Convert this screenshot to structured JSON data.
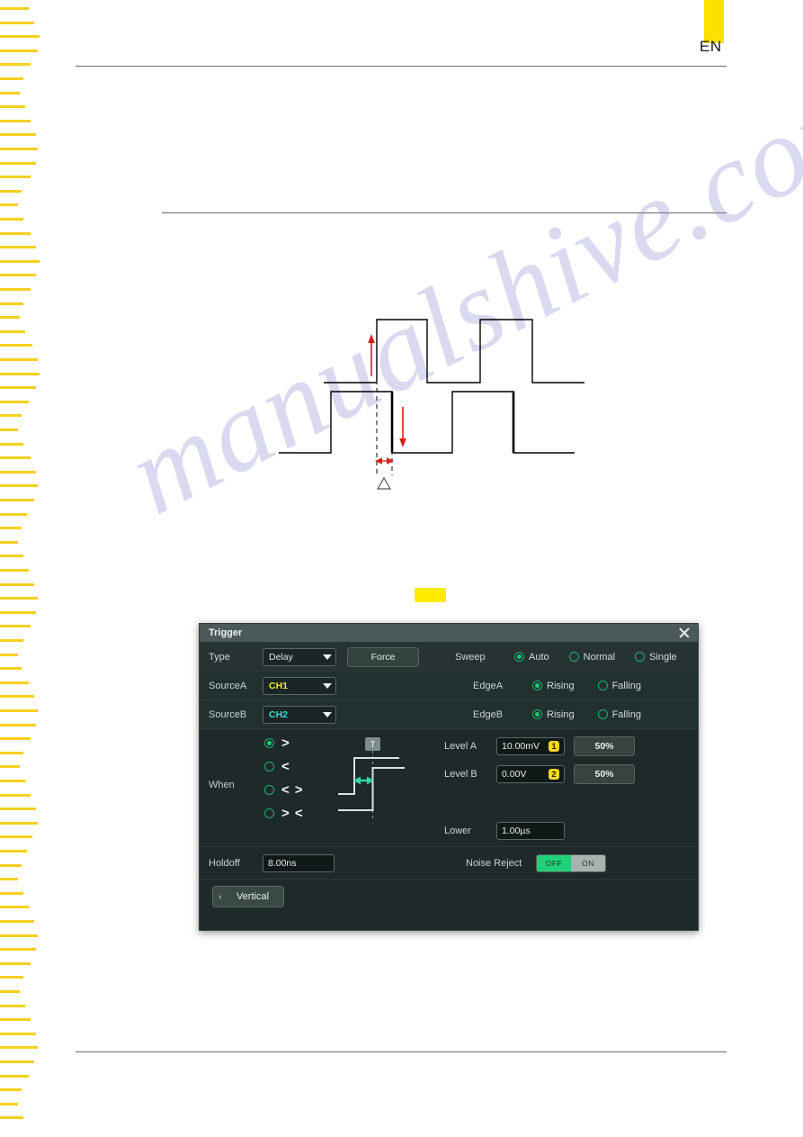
{
  "page": {
    "language_tab": "EN",
    "watermark": "manualshive.com"
  },
  "figure": {
    "name": "delay-trigger-waveform-diagram",
    "delta_marker": "△"
  },
  "dialog": {
    "title": "Trigger",
    "close_icon": "close-icon",
    "rows": {
      "type": {
        "label": "Type",
        "value": "Delay",
        "force_label": "Force",
        "sweep_label": "Sweep",
        "sweep_options": [
          {
            "label": "Auto",
            "selected": true
          },
          {
            "label": "Normal",
            "selected": false
          },
          {
            "label": "Single",
            "selected": false
          }
        ]
      },
      "source_a": {
        "label": "SourceA",
        "value": "CH1",
        "edge_label": "EdgeA",
        "edge_options": [
          {
            "label": "Rising",
            "selected": true
          },
          {
            "label": "Falling",
            "selected": false
          }
        ]
      },
      "source_b": {
        "label": "SourceB",
        "value": "CH2",
        "edge_label": "EdgeB",
        "edge_options": [
          {
            "label": "Rising",
            "selected": true
          },
          {
            "label": "Falling",
            "selected": false
          }
        ]
      },
      "when": {
        "label": "When",
        "options": [
          {
            "symbol": ">",
            "selected": true
          },
          {
            "symbol": "<",
            "selected": false
          },
          {
            "symbol": "< >",
            "selected": false
          },
          {
            "symbol": "> <",
            "selected": false
          }
        ]
      },
      "level_a": {
        "label": "Level A",
        "value": "10.00mV",
        "badge": "1",
        "percent_label": "50%"
      },
      "level_b": {
        "label": "Level B",
        "value": "0.00V",
        "badge": "2",
        "percent_label": "50%"
      },
      "lower": {
        "label": "Lower",
        "value": "1.00µs"
      },
      "holdoff": {
        "label": "Holdoff",
        "value": "8.00ns"
      },
      "noise_reject": {
        "label": "Noise Reject",
        "off_label": "OFF",
        "on_label": "ON",
        "selected": "OFF"
      }
    },
    "footer": {
      "back_label": "Vertical",
      "back_icon": "chevron-left-icon"
    }
  },
  "colors": {
    "accent_green": "#19c97a",
    "badge_yellow": "#f4d71b",
    "ch1_yellow": "#f2e23c",
    "ch2_cyan": "#3fd8d8",
    "dialog_bg": "#1e2a2a",
    "titlebar": "#4b5a59",
    "tick_yellow": "#f5d01e",
    "en_tab": "#fae100",
    "marker_red": "#e01b1b"
  }
}
